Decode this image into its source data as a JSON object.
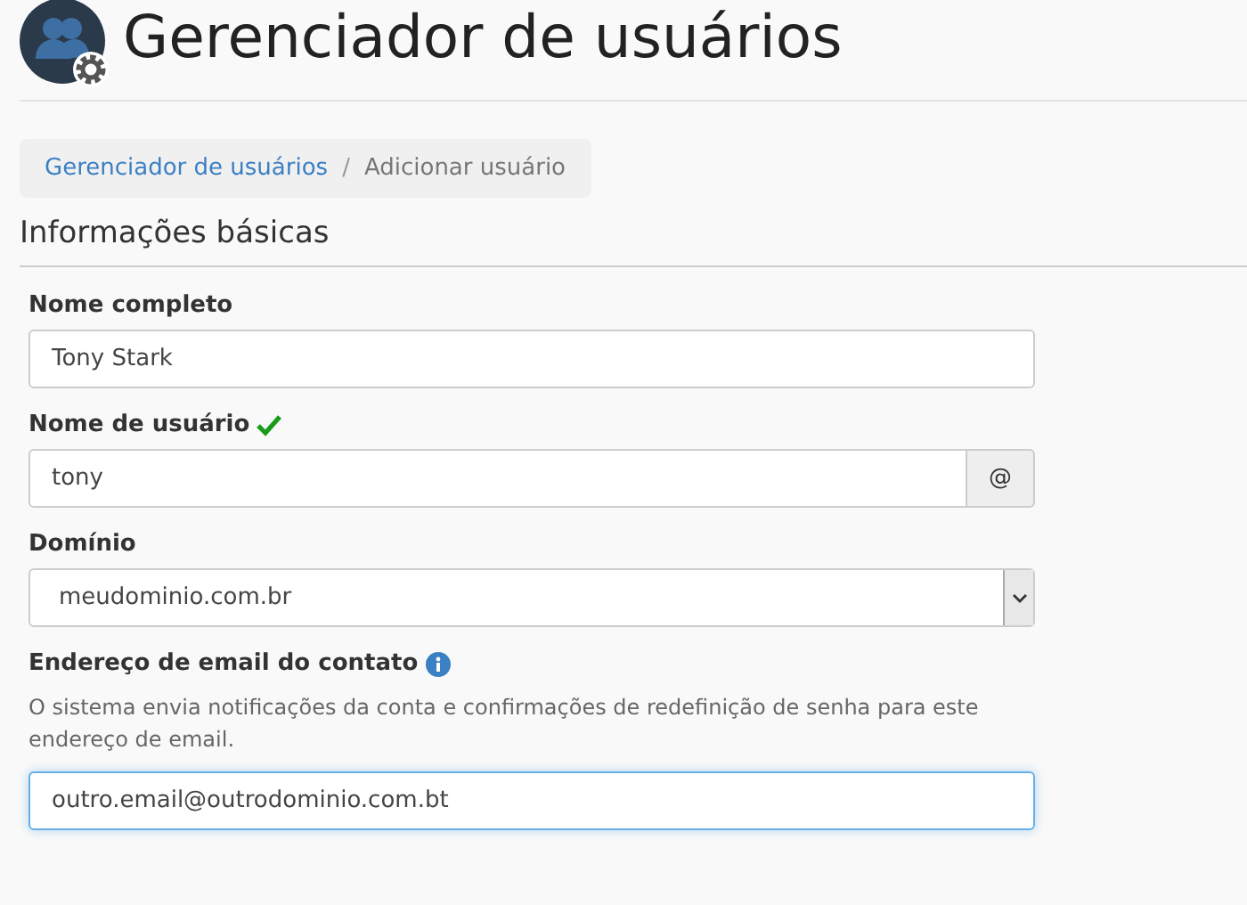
{
  "header": {
    "title": "Gerenciador de usuários"
  },
  "breadcrumb": [
    {
      "label": "Gerenciador de usuários",
      "kind": "link"
    },
    {
      "label": "Adicionar usuário",
      "kind": "current"
    }
  ],
  "breadcrumb_separator": "/",
  "section": {
    "title": "Informações básicas"
  },
  "fields": [
    {
      "kind": "text",
      "label": "Nome completo",
      "value": "Tony Stark",
      "valid": false,
      "info": false,
      "focused": false
    },
    {
      "kind": "addon",
      "label": "Nome de usuário",
      "value": "tony",
      "addon": "@",
      "valid": true,
      "info": false,
      "focused": false
    },
    {
      "kind": "select",
      "label": "Domínio",
      "value": "meudominio.com.br",
      "valid": false,
      "info": false,
      "focused": false
    },
    {
      "kind": "text",
      "label": "Endereço de email do contato",
      "help": "O sistema envia notificações da conta e confirmações de redefinição de senha para este endereço de email.",
      "value": "outro.email@outrodominio.com.bt",
      "valid": false,
      "info": true,
      "focused": true
    }
  ]
}
